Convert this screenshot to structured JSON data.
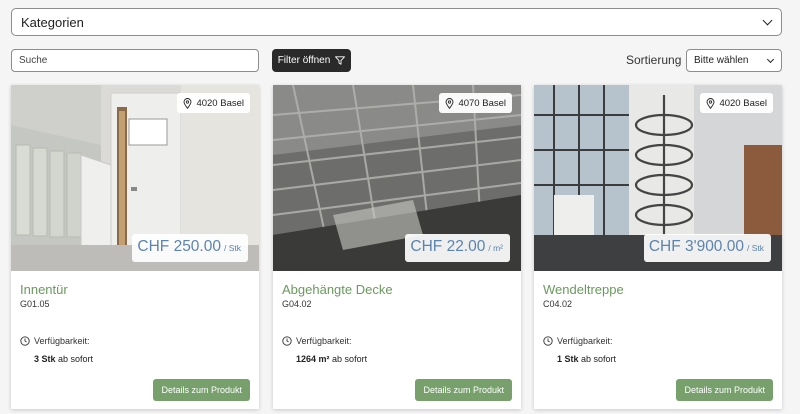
{
  "header": {
    "category_label": "Kategorien",
    "search_placeholder": "Suche",
    "filter_label": "Filter öffnen",
    "sort_label": "Sortierung",
    "sort_value": "Bitte wählen"
  },
  "products": [
    {
      "location": "4020 Basel",
      "price": "CHF 250.00",
      "unit": "/ Stk",
      "title": "Innentür",
      "code": "G01.05",
      "availability_label": "Verfügbarkeit:",
      "quantity": "3 Stk",
      "availability_text": "ab sofort",
      "button": "Details zum Produkt"
    },
    {
      "location": "4070 Basel",
      "price": "CHF 22.00",
      "unit": "/ m²",
      "title": "Abgehängte Decke",
      "code": "G04.02",
      "availability_label": "Verfügbarkeit:",
      "quantity": "1264 m²",
      "availability_text": "ab sofort",
      "button": "Details zum Produkt"
    },
    {
      "location": "4020 Basel",
      "price": "CHF 3'900.00",
      "unit": "/ Stk",
      "title": "Wendeltreppe",
      "code": "C04.02",
      "availability_label": "Verfügbarkeit:",
      "quantity": "1 Stk",
      "availability_text": "ab sofort",
      "button": "Details zum Produkt"
    }
  ],
  "colors": {
    "accent_green": "#77a06d",
    "title_green": "#6a9a5e",
    "price_blue": "#5b84b1",
    "dark_button": "#2a2a2a"
  }
}
